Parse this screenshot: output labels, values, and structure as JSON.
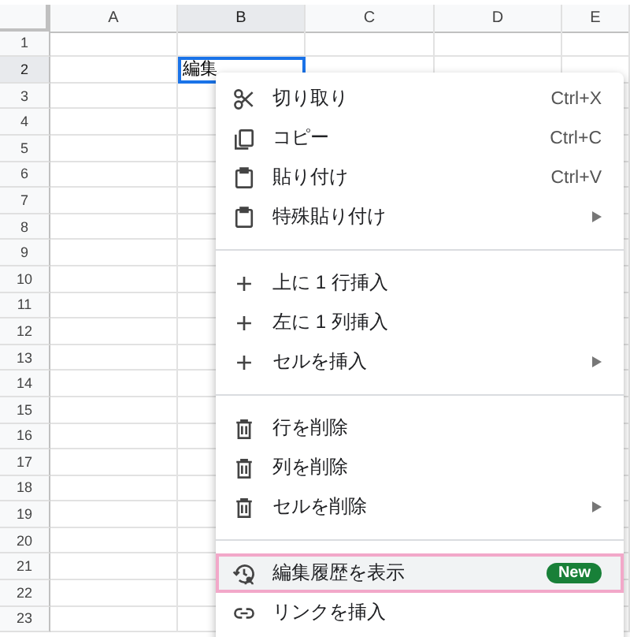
{
  "columns": [
    {
      "label": "A",
      "selected": false
    },
    {
      "label": "B",
      "selected": true
    },
    {
      "label": "C",
      "selected": false
    },
    {
      "label": "D",
      "selected": false
    },
    {
      "label": "E",
      "selected": false
    }
  ],
  "rows": [
    {
      "label": "1",
      "selected": false
    },
    {
      "label": "2",
      "selected": true
    },
    {
      "label": "3",
      "selected": false
    },
    {
      "label": "4",
      "selected": false
    },
    {
      "label": "5",
      "selected": false
    },
    {
      "label": "6",
      "selected": false
    },
    {
      "label": "7",
      "selected": false
    },
    {
      "label": "8",
      "selected": false
    },
    {
      "label": "9",
      "selected": false
    },
    {
      "label": "10",
      "selected": false
    },
    {
      "label": "11",
      "selected": false
    },
    {
      "label": "12",
      "selected": false
    },
    {
      "label": "13",
      "selected": false
    },
    {
      "label": "14",
      "selected": false
    },
    {
      "label": "15",
      "selected": false
    },
    {
      "label": "16",
      "selected": false
    },
    {
      "label": "17",
      "selected": false
    },
    {
      "label": "18",
      "selected": false
    },
    {
      "label": "19",
      "selected": false
    },
    {
      "label": "20",
      "selected": false
    },
    {
      "label": "21",
      "selected": false
    },
    {
      "label": "22",
      "selected": false
    },
    {
      "label": "23",
      "selected": false
    }
  ],
  "active_cell": {
    "text": "編集"
  },
  "context_menu": [
    {
      "kind": "item",
      "label": "切り取り",
      "shortcut": "Ctrl+X",
      "submenu": false,
      "highlighted": false
    },
    {
      "kind": "item",
      "label": "コピー",
      "shortcut": "Ctrl+C",
      "submenu": false,
      "highlighted": false
    },
    {
      "kind": "item",
      "label": "貼り付け",
      "shortcut": "Ctrl+V",
      "submenu": false,
      "highlighted": false
    },
    {
      "kind": "item",
      "label": "特殊貼り付け",
      "submenu": true,
      "highlighted": false
    },
    {
      "kind": "separator"
    },
    {
      "kind": "item",
      "label": "上に 1 行挿入",
      "submenu": false,
      "highlighted": false
    },
    {
      "kind": "item",
      "label": "左に 1 列挿入",
      "submenu": false,
      "highlighted": false
    },
    {
      "kind": "item",
      "label": "セルを挿入",
      "submenu": true,
      "highlighted": false
    },
    {
      "kind": "separator"
    },
    {
      "kind": "item",
      "label": "行を削除",
      "submenu": false,
      "highlighted": false
    },
    {
      "kind": "item",
      "label": "列を削除",
      "submenu": false,
      "highlighted": false
    },
    {
      "kind": "item",
      "label": "セルを削除",
      "submenu": true,
      "highlighted": false
    },
    {
      "kind": "separator"
    },
    {
      "kind": "item",
      "label": "編集履歴を表示",
      "badge": "New",
      "submenu": false,
      "highlighted": true
    },
    {
      "kind": "item",
      "label": "リンクを挿入",
      "submenu": false,
      "highlighted": false
    }
  ]
}
